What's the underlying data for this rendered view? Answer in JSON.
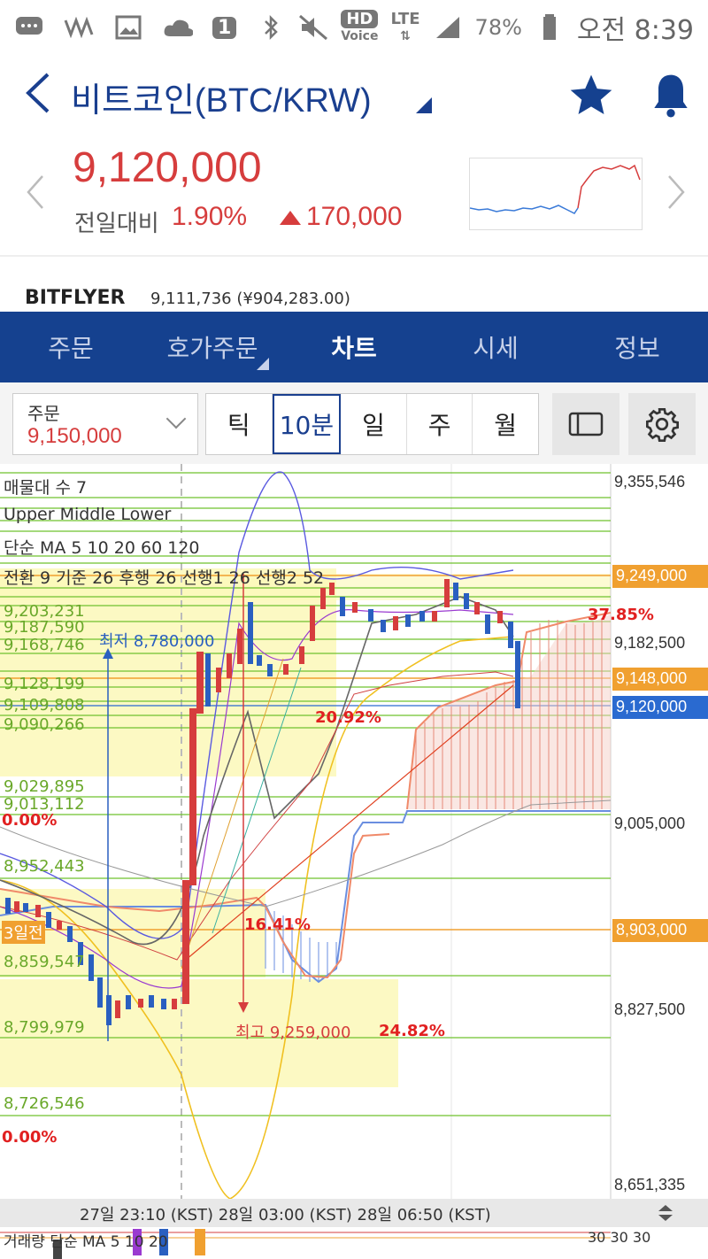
{
  "status_bar": {
    "battery": "78%",
    "time": "오전 8:39",
    "notification_count": "1",
    "hd_label": "HD",
    "voice_label": "Voice",
    "lte_label": "LTE"
  },
  "header": {
    "title": "비트코인(BTC/KRW)"
  },
  "price": {
    "current": "9,120,000",
    "change_label": "전일대비",
    "change_pct": "1.90%",
    "change_amount": "170,000"
  },
  "exchange": {
    "name": "BITFLYER",
    "price": "9,111,736 (¥904,283.00)"
  },
  "nav_tabs": [
    {
      "label": "주문"
    },
    {
      "label": "호가주문"
    },
    {
      "label": "차트"
    },
    {
      "label": "시세"
    },
    {
      "label": "정보"
    }
  ],
  "order_select": {
    "label": "주문",
    "value": "9,150,000"
  },
  "periods": [
    {
      "label": "틱"
    },
    {
      "label": "10분"
    },
    {
      "label": "일"
    },
    {
      "label": "주"
    },
    {
      "label": "월"
    }
  ],
  "chart": {
    "legend": {
      "volume_profile": "매물대 수 7",
      "bollinger": "Upper  Middle  Lower",
      "ma": "단순 MA  5  10  20  60  120",
      "ichimoku": "전환 9  기준 26  후행 26  선행1 26  선행2 52"
    },
    "axis_labels": [
      "9,355,546",
      "9,182,500",
      "9,005,000",
      "8,827,500",
      "8,651,335"
    ],
    "tags": {
      "upper": "9,249,000",
      "mid": "9,148,000",
      "current": "9,120,000",
      "lower": "8,903,000"
    },
    "level_labels": [
      "9,203,231",
      "9,187,590",
      "9,168,746",
      "9,128,199",
      "9,109,808",
      "9,090,266",
      "9,029,895",
      "9,013,112",
      "8,952,443",
      "8,859,547",
      "8,799,979",
      "8,726,546"
    ],
    "pct_labels": {
      "p3785": "37.85%",
      "p2092": "20.92%",
      "p0": "0.00%",
      "p1641": "16.41%",
      "p2482": "24.82%",
      "p0b": "0.00%"
    },
    "notes": {
      "low": "최저 8,780,000",
      "high": "최고 9,259,000",
      "three_days": "3일전"
    }
  },
  "time_axis": {
    "label": "27일 23:10 (KST) 28일 03:00 (KST) 28일 06:50 (KST)"
  },
  "sub_chart": {
    "legend": "거래량 단순 MA  5  10  20",
    "values": "30  30  30"
  },
  "colors": {
    "brand": "#15418f",
    "up": "#d63d3d",
    "down": "#2a5fc0",
    "orange_tag": "#f0a030",
    "blue_tag": "#2a6ad0"
  }
}
